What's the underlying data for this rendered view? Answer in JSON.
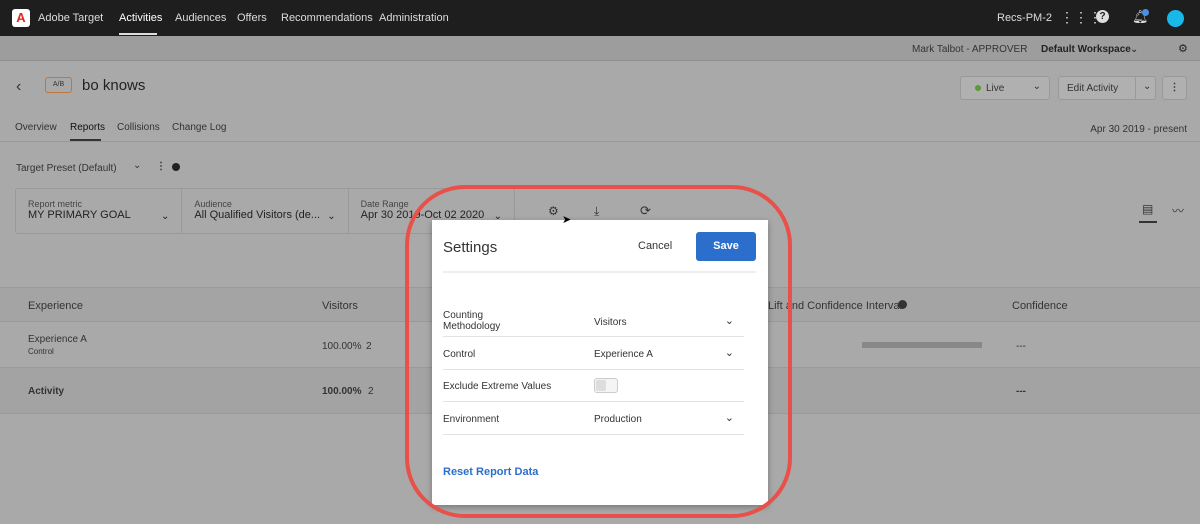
{
  "topnav": {
    "brand": "Adobe Target",
    "items": [
      "Activities",
      "Audiences",
      "Offers",
      "Recommendations",
      "Administration"
    ],
    "org": "Recs-PM-2"
  },
  "subbar": {
    "user": "Mark Talbot - APPROVER",
    "workspace": "Default Workspace"
  },
  "activity": {
    "type": "A/B",
    "name": "bo knows",
    "status": "Live",
    "edit": "Edit Activity",
    "date_range": "Apr 30 2019 - present"
  },
  "tabs": [
    "Overview",
    "Reports",
    "Collisions",
    "Change Log"
  ],
  "preset": "Target Preset (Default)",
  "filters": [
    {
      "label": "Report metric",
      "value": "MY PRIMARY GOAL"
    },
    {
      "label": "Audience",
      "value": "All Qualified Visitors (de..."
    },
    {
      "label": "Date Range",
      "value": "Apr 30 2019-Oct 02 2020"
    }
  ],
  "table": {
    "headers": [
      "Experience",
      "Visitors",
      "Lift and Confidence Interval",
      "Confidence"
    ],
    "rows": [
      {
        "name": "Experience A",
        "sub": "Control",
        "pct": "100.00%",
        "count": "2",
        "confidence": "---"
      },
      {
        "name": "Activity",
        "pct": "100.00%",
        "count": "2",
        "confidence": "---"
      }
    ]
  },
  "modal": {
    "title": "Settings",
    "cancel": "Cancel",
    "save": "Save",
    "rows": [
      {
        "label": "Counting Methodology",
        "value": "Visitors"
      },
      {
        "label": "Control",
        "value": "Experience A"
      },
      {
        "label": "Exclude Extreme Values",
        "toggle": false
      },
      {
        "label": "Environment",
        "value": "Production"
      }
    ],
    "reset": "Reset Report Data"
  },
  "colors": {
    "accent": "#2c6ecb",
    "highlight": "#e8514a",
    "live": "#5a9a3a"
  }
}
